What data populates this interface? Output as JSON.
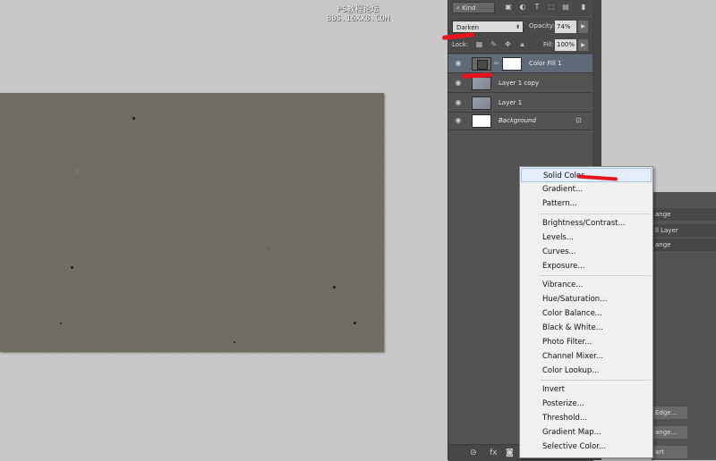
{
  "watermark": {
    "line1": "PS教程论坛",
    "line2": "BBS.16XX8.COM"
  },
  "layers_panel": {
    "filter_kind": "Kind",
    "blend_mode": "Darken",
    "opacity_label": "Opacity:",
    "opacity_value": "74%",
    "lock_label": "Lock:",
    "fill_label": "Fill:",
    "fill_value": "100%",
    "layers": [
      {
        "name": "Color Fill 1",
        "selected": true
      },
      {
        "name": "Layer 1 copy"
      },
      {
        "name": "Layer 1"
      },
      {
        "name": "Background",
        "italic": true,
        "locked": true
      }
    ]
  },
  "context_menu": {
    "groups": [
      [
        "Solid Color...",
        "Gradient...",
        "Pattern..."
      ],
      [
        "Brightness/Contrast...",
        "Levels...",
        "Curves...",
        "Exposure..."
      ],
      [
        "Vibrance...",
        "Hue/Saturation...",
        "Color Balance...",
        "Black & White...",
        "Photo Filter...",
        "Channel Mixer...",
        "Color Lookup..."
      ],
      [
        "Invert",
        "Posterize...",
        "Threshold...",
        "Gradient Map...",
        "Selective Color..."
      ]
    ],
    "highlighted": "Solid Color..."
  },
  "partial_panel": {
    "items": [
      "ange",
      "ll Layer",
      "ange",
      "Edge...",
      "ange...",
      "art"
    ]
  },
  "colors": {
    "panel": "#535353",
    "selected_layer": "#5e6a78",
    "annotation": "#e8161c",
    "menu_bg": "#f0f0f0"
  }
}
